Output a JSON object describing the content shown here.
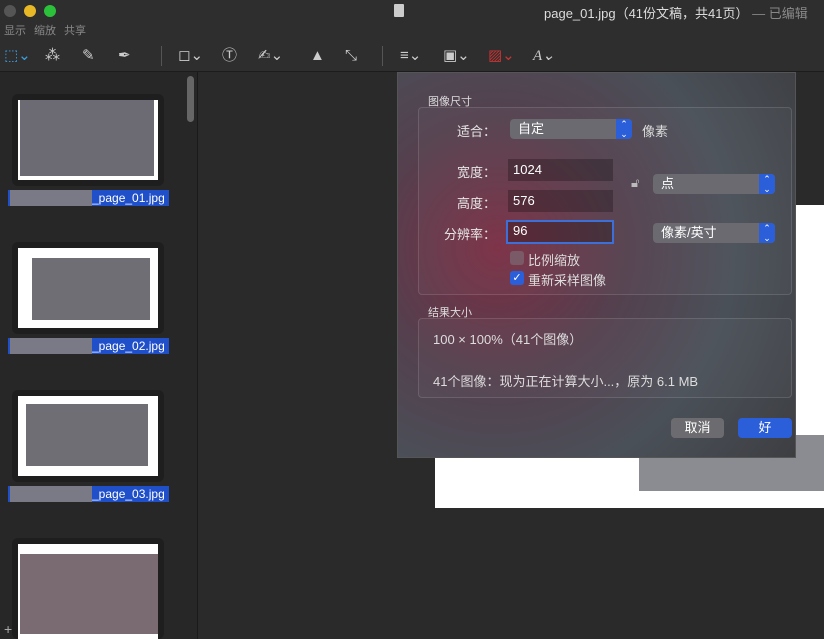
{
  "window": {
    "filename": "page_01.jpg",
    "title_info": "（41份文稿，共41页）",
    "edited": "— 已编辑"
  },
  "menu": [
    "显示",
    "缩放",
    "共享"
  ],
  "thumbnails": [
    {
      "label": "_page_01.jpg"
    },
    {
      "label": "_page_02.jpg"
    },
    {
      "label": "_page_03.jpg"
    }
  ],
  "dialog": {
    "section_size": "图像尺寸",
    "fit_label": "适合：",
    "fit_value": "自定",
    "fit_unit": "像素",
    "width_label": "宽度：",
    "width_value": "1024",
    "height_label": "高度：",
    "height_value": "576",
    "resolution_label": "分辨率：",
    "resolution_value": "96",
    "size_unit": "点",
    "resolution_unit": "像素/英寸",
    "scale_proportionally": "比例缩放",
    "scale_checked": false,
    "resample": "重新采样图像",
    "resample_checked": true,
    "section_result": "结果大小",
    "result_line1": "100 × 100%（41个图像）",
    "result_line2": "41个图像：现为正在计算大小...，原为 6.1 MB",
    "cancel": "取消",
    "ok": "好"
  },
  "colors": {
    "accent": "#2b5fd9",
    "selection": "#1f4fc9"
  }
}
